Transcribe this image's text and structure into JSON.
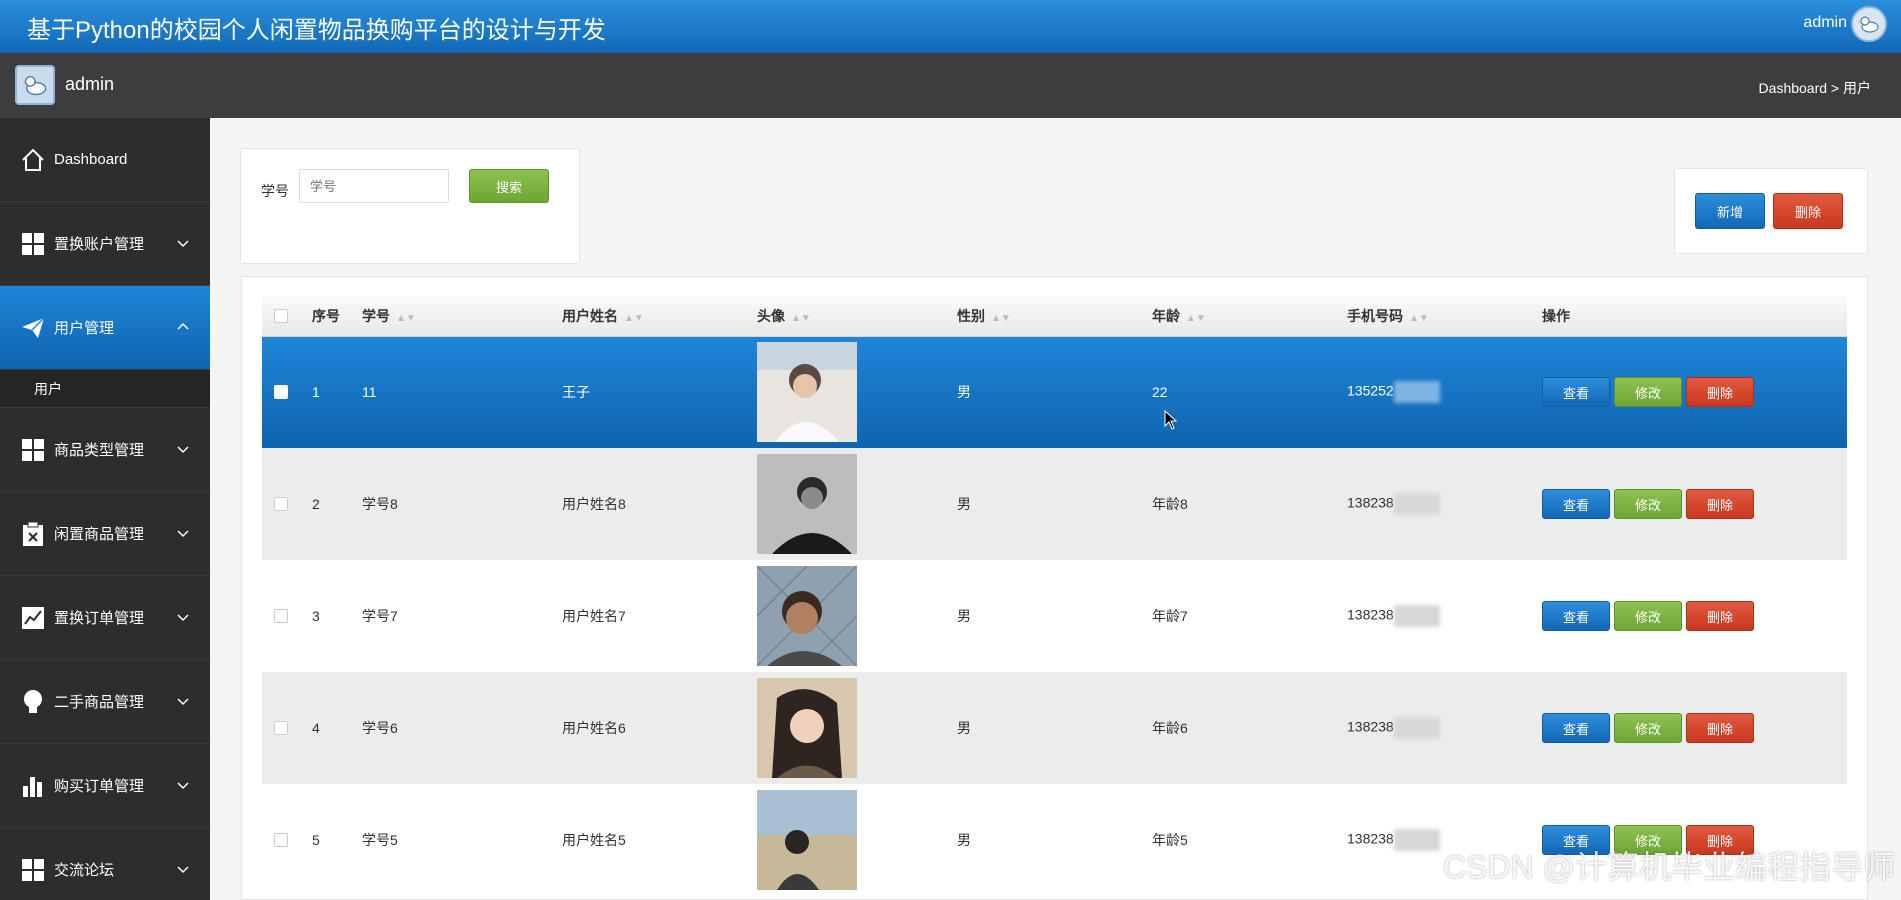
{
  "header": {
    "title": "基于Python的校园个人闲置物品换购平台的设计与开发",
    "user": "admin"
  },
  "subbar": {
    "name": "admin",
    "breadcrumb": "Dashboard > 用户"
  },
  "sidebar": {
    "items": [
      {
        "label": "Dashboard",
        "icon": "home-icon"
      },
      {
        "label": "置换账户管理",
        "icon": "grid-icon"
      },
      {
        "label": "用户管理",
        "icon": "paper-plane-icon"
      },
      {
        "label": "商品类型管理",
        "icon": "grid-icon"
      },
      {
        "label": "闲置商品管理",
        "icon": "clipboard-icon"
      },
      {
        "label": "置换订单管理",
        "icon": "chart-icon"
      },
      {
        "label": "二手商品管理",
        "icon": "lightbulb-icon"
      },
      {
        "label": "购买订单管理",
        "icon": "bar-chart-icon"
      },
      {
        "label": "交流论坛",
        "icon": "grid-icon"
      }
    ],
    "sub_item": "用户"
  },
  "search": {
    "label": "学号",
    "placeholder": "学号",
    "button": "搜索"
  },
  "actions": {
    "add": "新增",
    "delete": "删除"
  },
  "table": {
    "headers": [
      "序号",
      "学号",
      "用户姓名",
      "头像",
      "性别",
      "年龄",
      "手机号码",
      "操作"
    ],
    "rows": [
      {
        "idx": "1",
        "xh": "11",
        "name": "王子",
        "gender": "男",
        "age": "22",
        "phone": "135252"
      },
      {
        "idx": "2",
        "xh": "学号8",
        "name": "用户姓名8",
        "gender": "男",
        "age": "年龄8",
        "phone": "138238"
      },
      {
        "idx": "3",
        "xh": "学号7",
        "name": "用户姓名7",
        "gender": "男",
        "age": "年龄7",
        "phone": "138238"
      },
      {
        "idx": "4",
        "xh": "学号6",
        "name": "用户姓名6",
        "gender": "男",
        "age": "年龄6",
        "phone": "138238"
      },
      {
        "idx": "5",
        "xh": "学号5",
        "name": "用户姓名5",
        "gender": "男",
        "age": "年龄5",
        "phone": "138238"
      }
    ],
    "ops": {
      "view": "查看",
      "edit": "修改",
      "delete": "删除"
    }
  },
  "watermark": "CSDN @计算机毕业编程指导师",
  "colors": {
    "primary": "#1f85d6",
    "success": "#7cb342",
    "danger": "#d84a2c",
    "sidebar": "#2d2d2d"
  }
}
